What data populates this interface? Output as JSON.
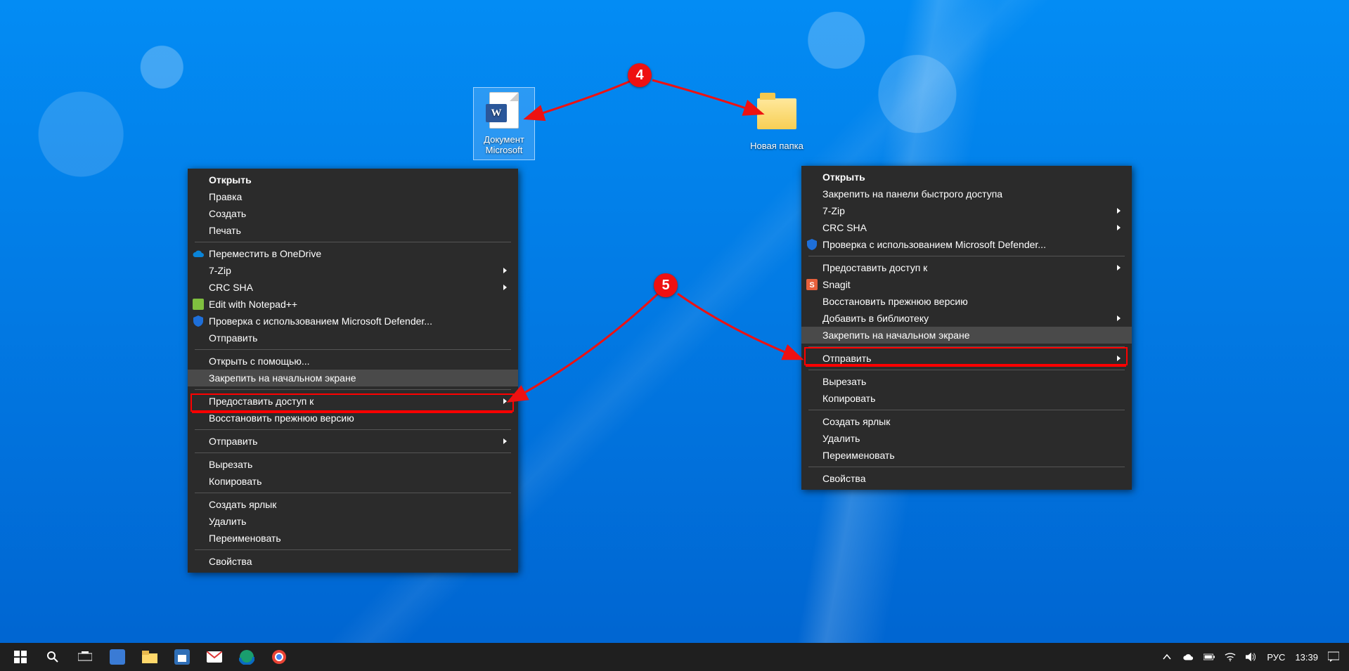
{
  "desktop": {
    "doc_label": "Документ\nMicrosoft",
    "folder_label": "Новая папка"
  },
  "callouts": {
    "c4": "4",
    "c5": "5"
  },
  "menu_left": {
    "open": "Открыть",
    "edit": "Правка",
    "create": "Создать",
    "print": "Печать",
    "onedrive": "Переместить в OneDrive",
    "sevenzip": "7-Zip",
    "crcsha": "CRC SHA",
    "notepadpp": "Edit with Notepad++",
    "defender": "Проверка с использованием Microsoft Defender...",
    "send": "Отправить",
    "openwith": "Открыть с помощью...",
    "pin_start": "Закрепить на начальном экране",
    "grant_access": "Предоставить доступ к",
    "restore_prev": "Восстановить прежнюю версию",
    "send_to": "Отправить",
    "cut": "Вырезать",
    "copy": "Копировать",
    "shortcut": "Создать ярлык",
    "delete": "Удалить",
    "rename": "Переименовать",
    "properties": "Свойства"
  },
  "menu_right": {
    "open": "Открыть",
    "pin_quick": "Закрепить на панели быстрого доступа",
    "sevenzip": "7-Zip",
    "crcsha": "CRC SHA",
    "defender": "Проверка с использованием Microsoft Defender...",
    "grant_access": "Предоставить доступ к",
    "snagit": "Snagit",
    "restore_prev": "Восстановить прежнюю версию",
    "add_library": "Добавить в библиотеку",
    "pin_start": "Закрепить на начальном экране",
    "send_to": "Отправить",
    "cut": "Вырезать",
    "copy": "Копировать",
    "shortcut": "Создать ярлык",
    "delete": "Удалить",
    "rename": "Переименовать",
    "properties": "Свойства"
  },
  "taskbar": {
    "lang": "РУС",
    "time": "13:39"
  }
}
